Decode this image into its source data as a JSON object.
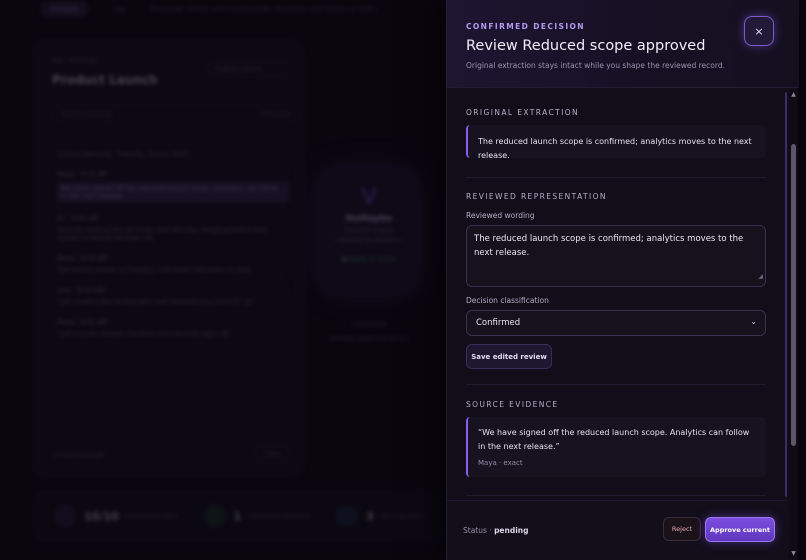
{
  "background": {
    "tabs": [
      "Analysis",
      "Log"
    ],
    "hint": "Transcript review and record-ready decisions and follow-up tasks",
    "card": {
      "crumb": "Ops · Meetings",
      "title": "Product Launch",
      "select": "Product Launch",
      "search_placeholder": "Search transcript",
      "search_count": "240 words",
      "lines": [
        {
          "kind": "meta",
          "text": "Launch planning · Tuesday, 15 July 2025"
        },
        {
          "kind": "speaker",
          "text": "Maya · 9:01 AM"
        },
        {
          "kind": "hl",
          "text": "We have signed off the reduced launch scope. Analytics can follow in the next release."
        },
        {
          "kind": "speaker",
          "text": "Jin · 9:02 AM"
        },
        {
          "kind": "text",
          "text": "Security testing will not finish until Monday. Shipping before that creates a release-window risk."
        },
        {
          "kind": "speaker",
          "text": "Maya · 9:03 AM"
        },
        {
          "kind": "text",
          "text": "The launch moves to Tuesday. I will brief customers on that."
        },
        {
          "kind": "speaker",
          "text": "Sam · 9:04 AM"
        },
        {
          "kind": "text",
          "text": "I will confirm the revised plan with Northstar by 2025-07-16."
        },
        {
          "kind": "speaker",
          "text": "Maya · 9:05 AM"
        },
        {
          "kind": "text",
          "text": "I will run the release checklist once security signs off."
        }
      ],
      "footer": "1 linked excerpt",
      "footer_button": "Clear"
    },
    "orb": {
      "mark": "V",
      "name": "NoMaybe",
      "sub": "Decision engine",
      "sub2": "Listening for decisions",
      "tag": "● Ready to review",
      "caption1": "Local mode",
      "caption2": "Nothing leaves the device"
    },
    "stats": [
      {
        "num": "10/10",
        "label": "Extraction status"
      },
      {
        "num": "1",
        "label": "Confirmed decisions"
      },
      {
        "num": "3",
        "label": "Pending tasks"
      }
    ]
  },
  "drawer": {
    "eyebrow": "CONFIRMED DECISION",
    "title": "Review Reduced scope approved",
    "subtitle": "Original extraction stays intact while you shape the reviewed record.",
    "close_label": "×",
    "original": {
      "label": "ORIGINAL EXTRACTION",
      "text": "The reduced launch scope is confirmed; analytics moves to the next release."
    },
    "reviewed": {
      "label": "REVIEWED REPRESENTATION",
      "wording_label": "Reviewed wording",
      "wording_value": "The reduced launch scope is confirmed; analytics moves to the next release.",
      "classification_label": "Decision classification",
      "classification_value": "Confirmed",
      "save_label": "Save edited review"
    },
    "evidence": {
      "label": "SOURCE EVIDENCE",
      "quote": "“We have signed off the reduced launch scope. Analytics can follow in the next release.”",
      "meta": "Maya · exact"
    },
    "footer": {
      "status_label": "Status ·",
      "status_value": "pending",
      "reject_label": "Reject",
      "approve_label": "Approve current"
    }
  },
  "icons": {
    "close": "close-icon",
    "chevron": "chevron-down-icon",
    "resize": "resize-grip-icon"
  },
  "colors": {
    "accent": "#8a5cf0",
    "panel": "#110d19",
    "reject": "#e4a6b4"
  }
}
